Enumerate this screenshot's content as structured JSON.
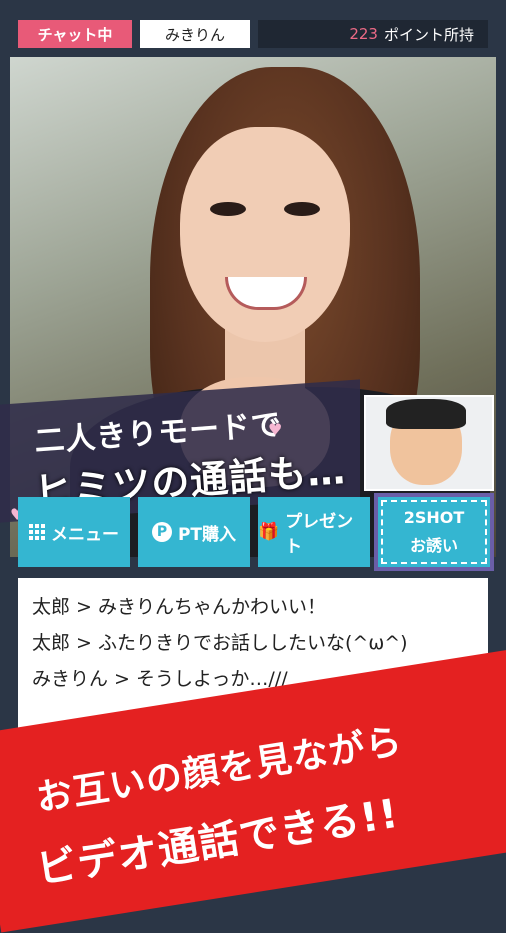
{
  "header": {
    "status": "チャット中",
    "partner_name": "みきりん",
    "points_value": "223",
    "points_label": "ポイント所持"
  },
  "video": {
    "promo_line1": "二人きりモードで",
    "promo_line2": "ヒミツの通話も…"
  },
  "actions": {
    "menu": "メニュー",
    "pt_purchase": "PT購入",
    "present": "プレゼント",
    "twoshot_line1": "2SHOT",
    "twoshot_line2": "お誘い"
  },
  "chat": {
    "messages": [
      "太郎 > みきりんちゃんかわいい！",
      "太郎 > ふたりきりでお話ししたいな(^ω^)",
      "みきりん > そうしよっか…///"
    ]
  },
  "banner": {
    "line1": "お互いの顔を見ながら",
    "line2": "ビデオ通話できる!!"
  },
  "colors": {
    "accent_pink": "#e85a78",
    "button_cyan": "#34b6d1",
    "banner_red": "#e42121",
    "bg_navy": "#2b3646"
  }
}
